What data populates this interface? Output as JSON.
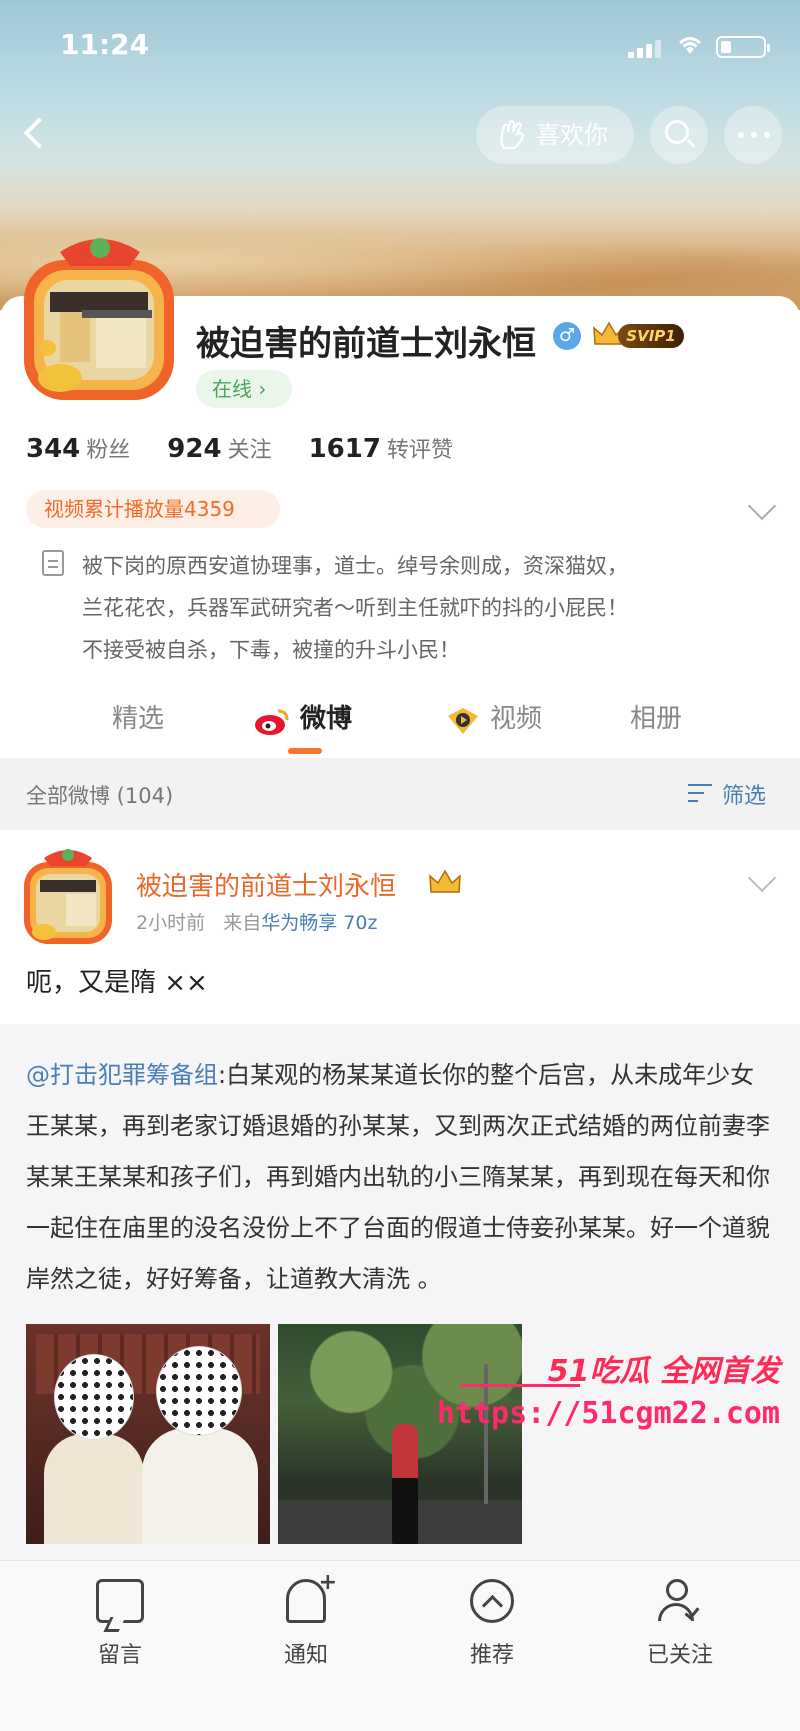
{
  "status_bar": {
    "time": "11:24"
  },
  "header": {
    "like_label": "喜欢你"
  },
  "profile": {
    "name": "被迫害的前道士刘永恒",
    "verified_symbol": "♂",
    "vip_badge": "SVIP1",
    "online_label": "在线 ›",
    "stats": [
      {
        "value": "344",
        "label": "粉丝"
      },
      {
        "value": "924",
        "label": "关注"
      },
      {
        "value": "1617",
        "label": "转评赞"
      }
    ],
    "video_plays": "视频累计播放量4359",
    "bio_lines": [
      "被下岗的原西安道协理事，道士。绰号余则成，资深猫奴，",
      "兰花花农，兵器军武研究者～听到主任就吓的抖的小屁民！",
      "不接受被自杀，下毒，被撞的升斗小民！"
    ]
  },
  "tabs": [
    {
      "label": "精选"
    },
    {
      "label": "微博"
    },
    {
      "label": "视频"
    },
    {
      "label": "相册"
    }
  ],
  "feed_header": {
    "count_label": "全部微博 (104)",
    "filter_label": "筛选"
  },
  "post": {
    "author": "被迫害的前道士刘永恒",
    "time": "2小时前",
    "source_prefix": "来自",
    "source": "华为畅享 70z",
    "text": "呃，又是隋 ××",
    "repost": {
      "mention": "@打击犯罪筹备组",
      "text": ":白某观的杨某某道长你的整个后宫，从未成年少女王某某，再到老家订婚退婚的孙某某，又到两次正式结婚的两位前妻李某某王某某和孩子们，再到婚内出轨的小三隋某某，再到现在每天和你一起住在庙里的没名没份上不了台面的假道士侍妾孙某某。好一个道貌岸然之徒，好好筹备，让道教大清洗 。"
    }
  },
  "watermark": {
    "brand": "51吃瓜 全网首发",
    "url": "https://51cgm22.com"
  },
  "bottom_bar": [
    {
      "label": "留言"
    },
    {
      "label": "通知"
    },
    {
      "label": "推荐"
    },
    {
      "label": "已关注"
    }
  ],
  "colors": {
    "accent": "#f5762b",
    "link": "#4a7fb5",
    "name_orange": "#e8692b",
    "online_green": "#4aa55a"
  }
}
